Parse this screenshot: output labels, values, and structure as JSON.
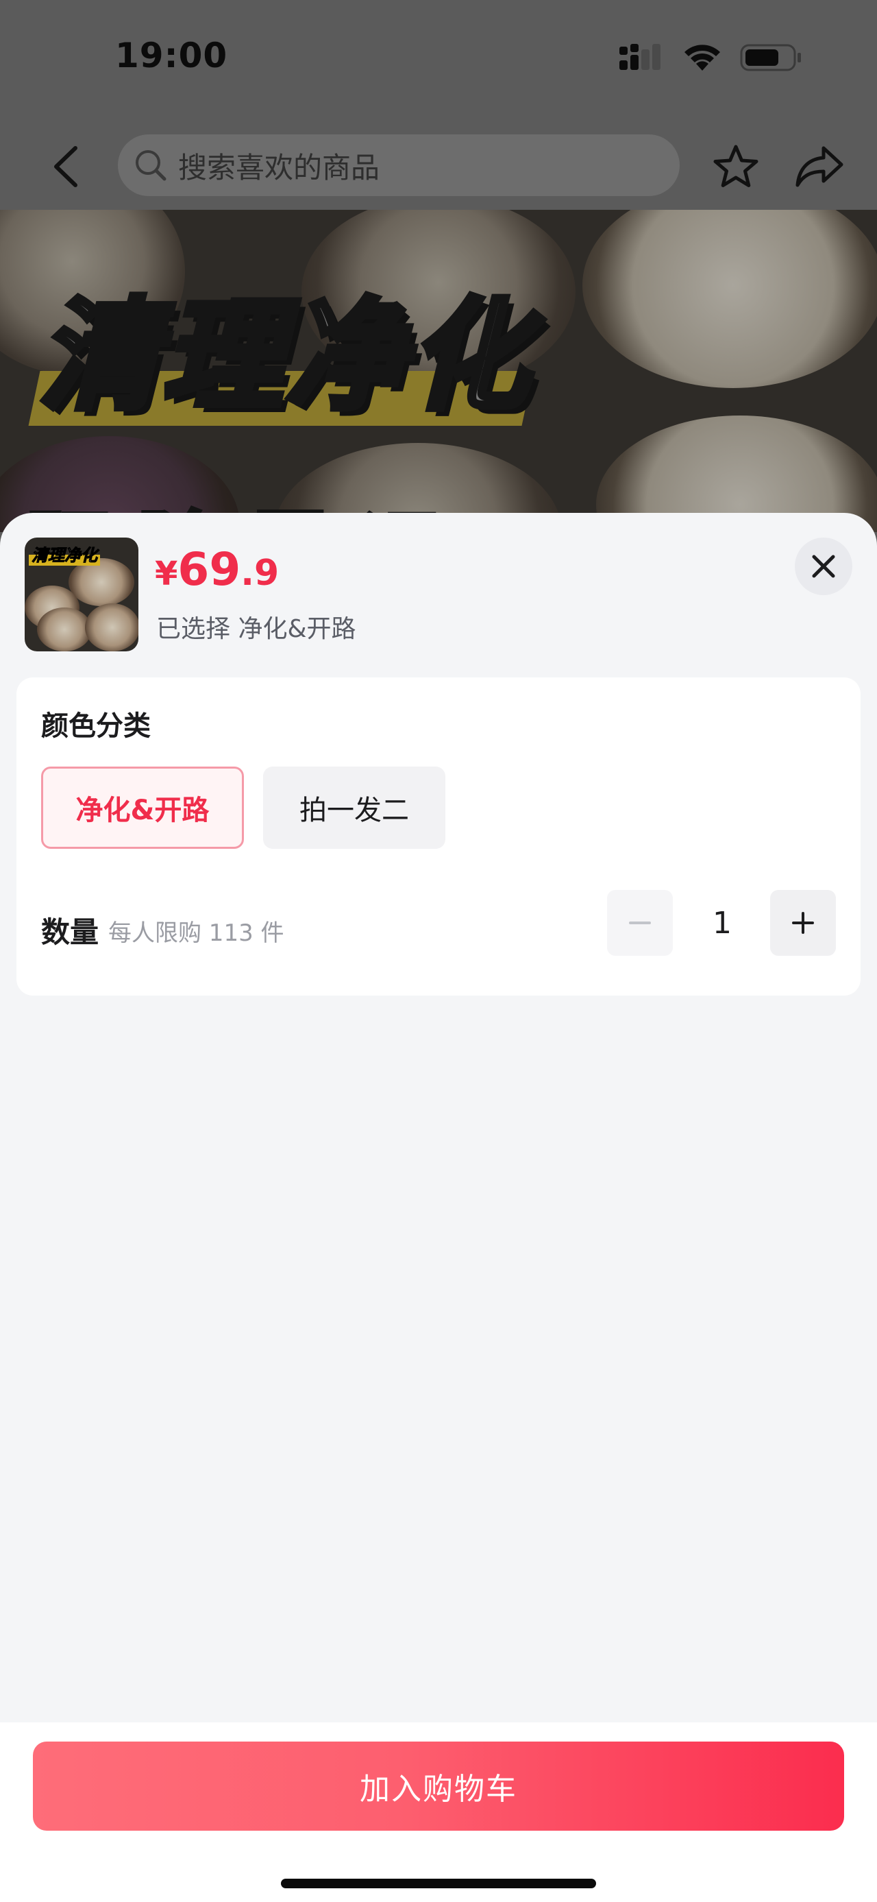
{
  "status_bar": {
    "time": "19:00"
  },
  "nav": {
    "search_placeholder": "搜索喜欢的商品"
  },
  "hero": {
    "title": "清理净化",
    "subtitle": "驱 除 霉 运"
  },
  "product": {
    "thumbnail_title": "清理净化",
    "currency": "¥",
    "price_int": "69",
    "price_dec": ".9",
    "selected_label": "已选择 净化&开路"
  },
  "options": {
    "section_title": "颜色分类",
    "items": [
      {
        "label": "净化&开路",
        "selected": true
      },
      {
        "label": "拍一发二",
        "selected": false
      }
    ]
  },
  "quantity": {
    "label": "数量",
    "limit_text": "每人限购 113 件",
    "value": "1"
  },
  "footer": {
    "add_to_cart_label": "加入购物车"
  },
  "colors": {
    "accent": "#f02d4b",
    "button_gradient_start": "#fe6d79",
    "button_gradient_end": "#fb2d4e",
    "sheet_bg": "#f4f5f7"
  },
  "icons": [
    "back-icon",
    "search-icon",
    "star-icon",
    "share-icon",
    "close-icon",
    "minus-icon",
    "plus-icon",
    "signal-icon",
    "wifi-icon",
    "battery-icon"
  ]
}
